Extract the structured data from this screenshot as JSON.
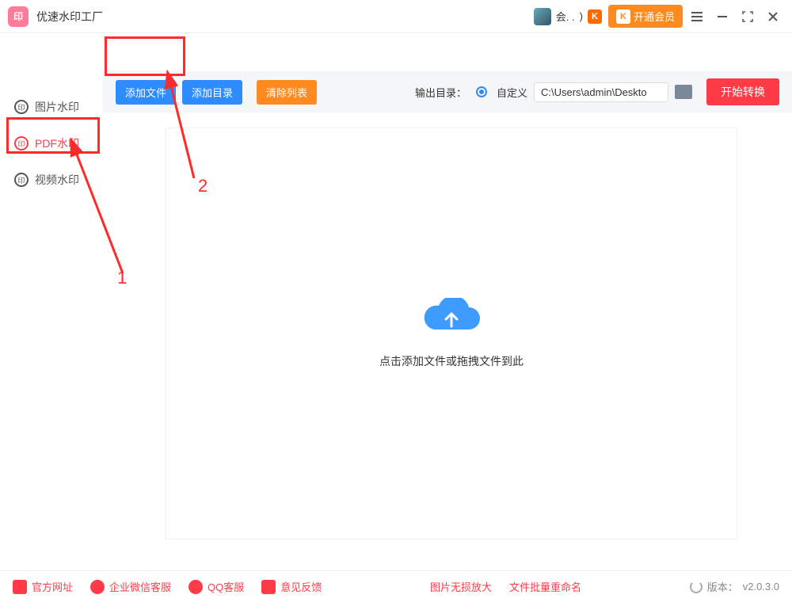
{
  "app": {
    "title": "优速水印工厂"
  },
  "titlebar": {
    "user_label": "会. .",
    "paren": ")",
    "vip_label": "开通会员"
  },
  "sidebar": {
    "items": [
      {
        "label": "图片水印"
      },
      {
        "label": "PDF水印"
      },
      {
        "label": "视频水印"
      }
    ]
  },
  "toolbar": {
    "add_file": "添加文件",
    "add_dir": "添加目录",
    "clear_list": "清除列表",
    "output_label": "输出目录：",
    "custom_label": "自定义",
    "path_value": "C:\\Users\\admin\\Deskto",
    "start_label": "开始转换"
  },
  "dropzone": {
    "text": "点击添加文件或拖拽文件到此"
  },
  "footer": {
    "site": "官方网址",
    "wecom": "企业微信客服",
    "qq": "QQ客服",
    "feedback": "意见反馈",
    "zoom": "图片无损放大",
    "rename": "文件批量重命名",
    "version_label": "版本：",
    "version_value": "v2.0.3.0"
  },
  "annotations": {
    "num1": "1",
    "num2": "2"
  }
}
